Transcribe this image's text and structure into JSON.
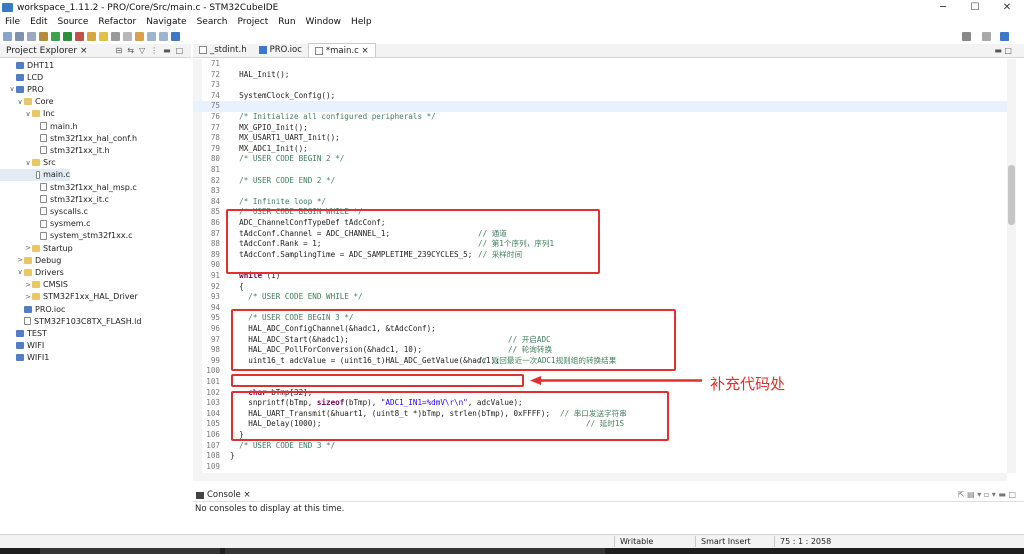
{
  "window": {
    "title": "workspace_1.11.2 - PRO/Core/Src/main.c - STM32CubeIDE",
    "minimize": "─",
    "maximize": "☐",
    "close": "✕"
  },
  "menu": [
    "File",
    "Edit",
    "Source",
    "Refactor",
    "Navigate",
    "Search",
    "Project",
    "Run",
    "Window",
    "Help"
  ],
  "project_explorer": {
    "tab_label": "Project Explorer ×",
    "tree": [
      {
        "label": "DHT11",
        "twisty": "",
        "icon": "proj"
      },
      {
        "label": "LCD",
        "twisty": "",
        "icon": "proj"
      },
      {
        "label": "PRO",
        "twisty": "∨",
        "icon": "proj"
      },
      {
        "label": "Core",
        "twisty": "∨",
        "icon": "folder"
      },
      {
        "label": "Inc",
        "twisty": "∨",
        "icon": "folder"
      },
      {
        "label": "main.h",
        "twisty": "",
        "icon": "file"
      },
      {
        "label": "stm32f1xx_hal_conf.h",
        "twisty": "",
        "icon": "file"
      },
      {
        "label": "stm32f1xx_it.h",
        "twisty": "",
        "icon": "file"
      },
      {
        "label": "Src",
        "twisty": "∨",
        "icon": "folder"
      },
      {
        "label": "main.c",
        "twisty": "",
        "icon": "file",
        "selected": true
      },
      {
        "label": "stm32f1xx_hal_msp.c",
        "twisty": "",
        "icon": "file"
      },
      {
        "label": "stm32f1xx_it.c",
        "twisty": "",
        "icon": "file"
      },
      {
        "label": "syscalls.c",
        "twisty": "",
        "icon": "file"
      },
      {
        "label": "sysmem.c",
        "twisty": "",
        "icon": "file"
      },
      {
        "label": "system_stm32f1xx.c",
        "twisty": "",
        "icon": "file"
      },
      {
        "label": "Startup",
        "twisty": ">",
        "icon": "folder"
      },
      {
        "label": "Debug",
        "twisty": ">",
        "icon": "folder"
      },
      {
        "label": "Drivers",
        "twisty": "∨",
        "icon": "folder"
      },
      {
        "label": "CMSIS",
        "twisty": ">",
        "icon": "folder"
      },
      {
        "label": "STM32F1xx_HAL_Driver",
        "twisty": ">",
        "icon": "folder"
      },
      {
        "label": "PRO.ioc",
        "twisty": "",
        "icon": "proj"
      },
      {
        "label": "STM32F103C8TX_FLASH.ld",
        "twisty": "",
        "icon": "file"
      },
      {
        "label": "TEST",
        "twisty": "",
        "icon": "proj"
      },
      {
        "label": "WIFI",
        "twisty": "",
        "icon": "proj"
      },
      {
        "label": "WIFI1",
        "twisty": "",
        "icon": "proj"
      }
    ]
  },
  "editor_tabs": [
    {
      "label": "_stdint.h",
      "icon": "file",
      "active": false
    },
    {
      "label": "PRO.ioc",
      "icon": "ioc",
      "active": false
    },
    {
      "label": "*main.c ×",
      "icon": "file",
      "active": true
    }
  ],
  "code_lines": [
    {
      "n": "71",
      "t": ""
    },
    {
      "n": "72",
      "t": "  HAL_Init();"
    },
    {
      "n": "73",
      "t": ""
    },
    {
      "n": "74",
      "t": "  SystemClock_Config();"
    },
    {
      "n": "75",
      "t": "",
      "cur": true
    },
    {
      "n": "76",
      "t": "  /* Initialize all configured peripherals */",
      "cls": "c-com"
    },
    {
      "n": "77",
      "t": "  MX_GPIO_Init();"
    },
    {
      "n": "78",
      "t": "  MX_USART1_UART_Init();"
    },
    {
      "n": "79",
      "t": "  MX_ADC1_Init();"
    },
    {
      "n": "80",
      "t": "  /* USER CODE BEGIN 2 */",
      "cls": "c-com"
    },
    {
      "n": "81",
      "t": ""
    },
    {
      "n": "82",
      "t": "  /* USER CODE END 2 */",
      "cls": "c-com"
    },
    {
      "n": "83",
      "t": ""
    },
    {
      "n": "84",
      "t": "  /* Infinite loop */",
      "cls": "c-com"
    },
    {
      "n": "85",
      "t": "  /* USER CODE BEGIN WHILE */",
      "cls": "c-com"
    },
    {
      "n": "86",
      "t": "  ADC_ChannelConfTypeDef tAdcConf;"
    },
    {
      "n": "87",
      "t": "  tAdcConf.Channel = ADC_CHANNEL_1;",
      "c": "// 通道"
    },
    {
      "n": "88",
      "t": "  tAdcConf.Rank = 1;",
      "c": "// 第1个序列，序列1"
    },
    {
      "n": "89",
      "t": "  tAdcConf.SamplingTime = ADC_SAMPLETIME_239CYCLES_5;",
      "c": "// 采样时间"
    },
    {
      "n": "90",
      "t": ""
    },
    {
      "n": "91",
      "kw": "while",
      "t": " (1)"
    },
    {
      "n": "92",
      "t": "  {"
    },
    {
      "n": "93",
      "t": "    /* USER CODE END WHILE */",
      "cls": "c-com"
    },
    {
      "n": "94",
      "t": ""
    },
    {
      "n": "95",
      "t": "    /* USER CODE BEGIN 3 */",
      "cls": "c-com"
    },
    {
      "n": "96",
      "t": "    HAL_ADC_ConfigChannel(&hadc1, &tAdcConf);"
    },
    {
      "n": "97",
      "t": "    HAL_ADC_Start(&hadc1);",
      "c": "// 开启ADC"
    },
    {
      "n": "98",
      "t": "    HAL_ADC_PollForConversion(&hadc1, 10);",
      "c": "// 轮询转换"
    },
    {
      "n": "99",
      "t": "    uint16_t adcValue = (uint16_t)HAL_ADC_GetValue(&hadc1);",
      "c": "// 返回最近一次ADC1规则组的转换结果"
    },
    {
      "n": "100",
      "t": ""
    },
    {
      "n": "101",
      "t": ""
    },
    {
      "n": "102",
      "kw": "char",
      "t": " bTmp[32];"
    },
    {
      "n": "103",
      "t": "    snprintf(bTmp, ",
      "kw2": "sizeof",
      "t2": "(bTmp), ",
      "s": "\"ADC1_IN1=%dmV\\r\\n\"",
      "t3": ", adcValue);"
    },
    {
      "n": "104",
      "t": "    HAL_UART_Transmit(&huart1, (uint8_t *)bTmp, strlen(bTmp), 0xFFFF);",
      "c": "// 串口发送字符串"
    },
    {
      "n": "105",
      "t": "    HAL_Delay(1000);",
      "c": "// 延时1S"
    },
    {
      "n": "106",
      "t": "  }"
    },
    {
      "n": "107",
      "t": "  /* USER CODE END 3 */",
      "cls": "c-com"
    },
    {
      "n": "108",
      "t": "}"
    },
    {
      "n": "109",
      "t": ""
    }
  ],
  "annotation": {
    "text": "补充代码处",
    "color": "#e03030"
  },
  "console": {
    "tab_label": "Console ×",
    "message": "No consoles to display at this time."
  },
  "status": {
    "writable": "Writable",
    "insert_mode": "Smart Insert",
    "position": "75 : 1 : 2058"
  },
  "colors": {
    "accent": "#3b79c6",
    "highlight_box": "#e03030",
    "comment": "#3f7f5f",
    "keyword": "#7f0055",
    "string": "#2a00ff"
  }
}
